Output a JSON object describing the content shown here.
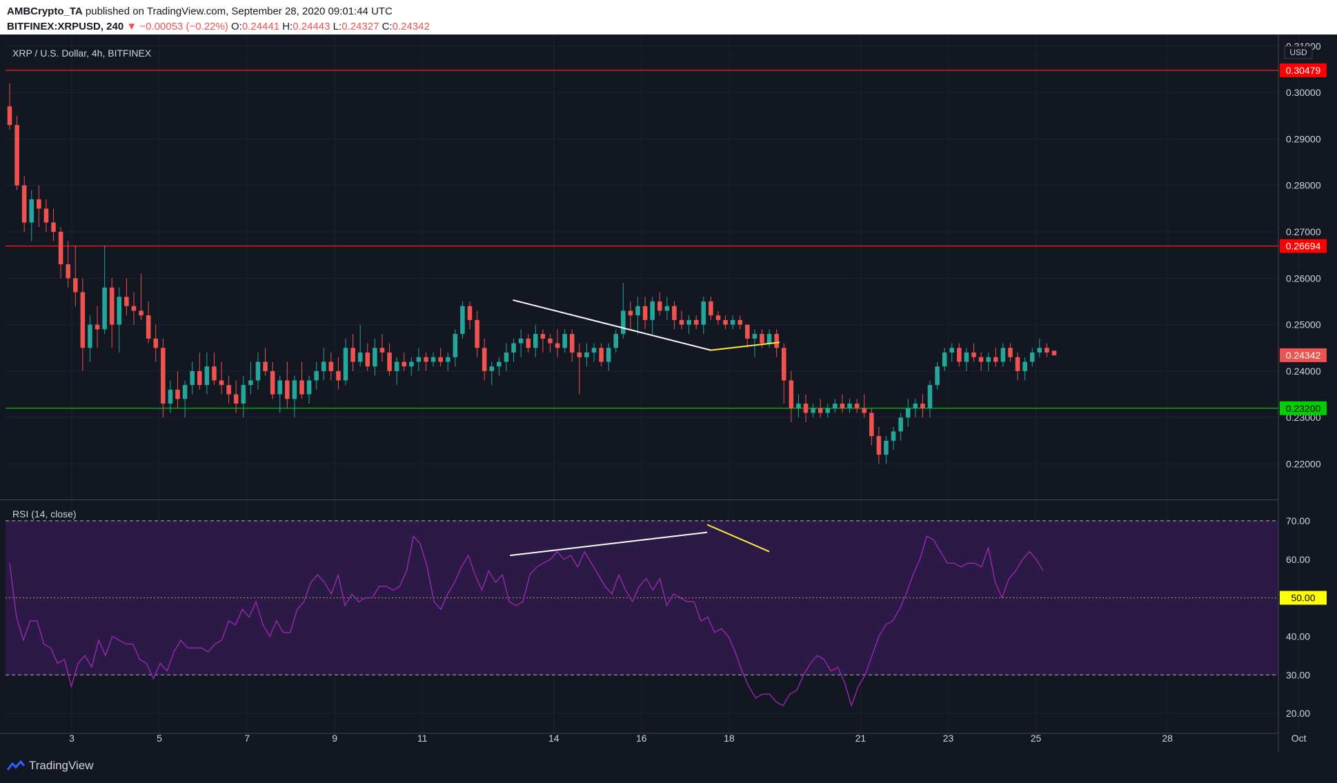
{
  "header": {
    "publisher": "AMBCrypto_TA",
    "published_text": " published on TradingView.com, September 28, 2020 09:01:44 UTC",
    "symbol": "BITFINEX:XRPUSD, 240",
    "change": "▼ −0.00053 (−0.22%)",
    "o_label": "O:",
    "o_value": "0.24441",
    "h_label": "H:",
    "h_value": "0.24443",
    "l_label": "L:",
    "l_value": "0.24327",
    "c_label": "C:",
    "c_value": "0.24342"
  },
  "footer": {
    "brand": "TradingView",
    "logo_icon": "tradingview-logo-icon"
  },
  "colors": {
    "background": "#131722",
    "grid": "#1e222d",
    "up": "#26a69a",
    "down": "#ef5350",
    "resistance": "#ff1e1e",
    "support": "#00c800",
    "rsi": "#9c27b0",
    "rsi_band": "#2a1a45",
    "trend_white": "#ffffff",
    "trend_yellow": "#ffeb3b"
  },
  "chart_data": [
    {
      "type": "candlestick",
      "title": "XRP / U.S. Dollar, 4h, BITFINEX",
      "currency_label": "USD",
      "ylim": [
        0.2125,
        0.3125
      ],
      "y_ticks": [
        "0.31000",
        "0.30000",
        "0.29000",
        "0.28000",
        "0.27000",
        "0.26000",
        "0.25000",
        "0.24000",
        "0.23000",
        "0.22000"
      ],
      "x_ticks": [
        "3",
        "5",
        "7",
        "9",
        "11",
        "14",
        "16",
        "18",
        "21",
        "23",
        "25",
        "28",
        "Oct",
        "3"
      ],
      "horizontal_levels": [
        {
          "value": 0.30479,
          "label": "0.30479",
          "color": "#ff1e1e"
        },
        {
          "value": 0.26694,
          "label": "0.26694",
          "color": "#ff1e1e"
        },
        {
          "value": 0.232,
          "label": "0.23200",
          "color": "#00c800"
        }
      ],
      "last_price": {
        "value": 0.24342,
        "label": "0.24342"
      },
      "trendlines": [
        {
          "color": "white",
          "points": [
            [
              68.9,
              0.2553
            ],
            [
              96.0,
              0.2445
            ]
          ]
        },
        {
          "color": "yellow",
          "points": [
            [
              96.0,
              0.2445
            ],
            [
              105.4,
              0.2462
            ]
          ]
        }
      ],
      "candles": [
        [
          0.297,
          0.302,
          0.292,
          0.293
        ],
        [
          0.293,
          0.295,
          0.279,
          0.28
        ],
        [
          0.28,
          0.282,
          0.27,
          0.272
        ],
        [
          0.272,
          0.279,
          0.268,
          0.277
        ],
        [
          0.277,
          0.28,
          0.271,
          0.275
        ],
        [
          0.275,
          0.277,
          0.27,
          0.272
        ],
        [
          0.272,
          0.275,
          0.268,
          0.27
        ],
        [
          0.27,
          0.271,
          0.26,
          0.263
        ],
        [
          0.263,
          0.268,
          0.258,
          0.26
        ],
        [
          0.26,
          0.267,
          0.254,
          0.257
        ],
        [
          0.257,
          0.26,
          0.24,
          0.245
        ],
        [
          0.245,
          0.252,
          0.242,
          0.25
        ],
        [
          0.25,
          0.254,
          0.245,
          0.249
        ],
        [
          0.249,
          0.267,
          0.248,
          0.258
        ],
        [
          0.258,
          0.26,
          0.245,
          0.25
        ],
        [
          0.25,
          0.258,
          0.244,
          0.256
        ],
        [
          0.256,
          0.26,
          0.252,
          0.254
        ],
        [
          0.254,
          0.257,
          0.25,
          0.253
        ],
        [
          0.253,
          0.261,
          0.251,
          0.252
        ],
        [
          0.252,
          0.255,
          0.246,
          0.247
        ],
        [
          0.247,
          0.25,
          0.242,
          0.245
        ],
        [
          0.245,
          0.247,
          0.23,
          0.233
        ],
        [
          0.233,
          0.238,
          0.231,
          0.236
        ],
        [
          0.236,
          0.24,
          0.232,
          0.234
        ],
        [
          0.234,
          0.238,
          0.23,
          0.237
        ],
        [
          0.237,
          0.242,
          0.235,
          0.24
        ],
        [
          0.24,
          0.244,
          0.236,
          0.237
        ],
        [
          0.237,
          0.244,
          0.235,
          0.241
        ],
        [
          0.241,
          0.244,
          0.237,
          0.238
        ],
        [
          0.238,
          0.242,
          0.235,
          0.237
        ],
        [
          0.237,
          0.239,
          0.233,
          0.235
        ],
        [
          0.235,
          0.238,
          0.231,
          0.233
        ],
        [
          0.233,
          0.239,
          0.23,
          0.237
        ],
        [
          0.237,
          0.242,
          0.235,
          0.238
        ],
        [
          0.238,
          0.244,
          0.236,
          0.242
        ],
        [
          0.242,
          0.245,
          0.239,
          0.24
        ],
        [
          0.24,
          0.242,
          0.234,
          0.235
        ],
        [
          0.235,
          0.239,
          0.231,
          0.238
        ],
        [
          0.238,
          0.242,
          0.232,
          0.234
        ],
        [
          0.234,
          0.239,
          0.23,
          0.238
        ],
        [
          0.238,
          0.242,
          0.234,
          0.235
        ],
        [
          0.235,
          0.239,
          0.233,
          0.238
        ],
        [
          0.238,
          0.242,
          0.236,
          0.24
        ],
        [
          0.24,
          0.245,
          0.238,
          0.242
        ],
        [
          0.242,
          0.244,
          0.238,
          0.24
        ],
        [
          0.24,
          0.243,
          0.236,
          0.238
        ],
        [
          0.238,
          0.247,
          0.237,
          0.245
        ],
        [
          0.245,
          0.248,
          0.24,
          0.242
        ],
        [
          0.242,
          0.25,
          0.241,
          0.244
        ],
        [
          0.244,
          0.246,
          0.24,
          0.241
        ],
        [
          0.241,
          0.247,
          0.239,
          0.245
        ],
        [
          0.245,
          0.248,
          0.242,
          0.244
        ],
        [
          0.244,
          0.246,
          0.239,
          0.24
        ],
        [
          0.24,
          0.243,
          0.237,
          0.242
        ],
        [
          0.242,
          0.244,
          0.24,
          0.241
        ],
        [
          0.241,
          0.243,
          0.239,
          0.242
        ],
        [
          0.242,
          0.245,
          0.24,
          0.243
        ],
        [
          0.243,
          0.244,
          0.24,
          0.242
        ],
        [
          0.242,
          0.244,
          0.241,
          0.243
        ],
        [
          0.243,
          0.245,
          0.241,
          0.242
        ],
        [
          0.242,
          0.244,
          0.24,
          0.243
        ],
        [
          0.243,
          0.249,
          0.241,
          0.248
        ],
        [
          0.248,
          0.255,
          0.247,
          0.254
        ],
        [
          0.254,
          0.255,
          0.249,
          0.251
        ],
        [
          0.251,
          0.253,
          0.243,
          0.245
        ],
        [
          0.245,
          0.247,
          0.238,
          0.24
        ],
        [
          0.24,
          0.242,
          0.237,
          0.241
        ],
        [
          0.241,
          0.243,
          0.239,
          0.242
        ],
        [
          0.242,
          0.246,
          0.24,
          0.244
        ],
        [
          0.244,
          0.247,
          0.242,
          0.246
        ],
        [
          0.246,
          0.249,
          0.243,
          0.247
        ],
        [
          0.247,
          0.248,
          0.244,
          0.245
        ],
        [
          0.245,
          0.25,
          0.243,
          0.248
        ],
        [
          0.248,
          0.249,
          0.244,
          0.247
        ],
        [
          0.247,
          0.248,
          0.244,
          0.246
        ],
        [
          0.246,
          0.249,
          0.243,
          0.245
        ],
        [
          0.245,
          0.249,
          0.244,
          0.248
        ],
        [
          0.248,
          0.249,
          0.242,
          0.244
        ],
        [
          0.244,
          0.246,
          0.235,
          0.243
        ],
        [
          0.243,
          0.246,
          0.241,
          0.244
        ],
        [
          0.244,
          0.246,
          0.242,
          0.245
        ],
        [
          0.245,
          0.246,
          0.241,
          0.242
        ],
        [
          0.242,
          0.246,
          0.24,
          0.245
        ],
        [
          0.245,
          0.249,
          0.244,
          0.248
        ],
        [
          0.248,
          0.259,
          0.247,
          0.253
        ],
        [
          0.253,
          0.255,
          0.249,
          0.252
        ],
        [
          0.252,
          0.256,
          0.248,
          0.254
        ],
        [
          0.254,
          0.256,
          0.249,
          0.251
        ],
        [
          0.251,
          0.256,
          0.248,
          0.255
        ],
        [
          0.255,
          0.257,
          0.252,
          0.253
        ],
        [
          0.253,
          0.256,
          0.251,
          0.254
        ],
        [
          0.254,
          0.255,
          0.249,
          0.251
        ],
        [
          0.251,
          0.253,
          0.249,
          0.25
        ],
        [
          0.25,
          0.252,
          0.248,
          0.251
        ],
        [
          0.251,
          0.252,
          0.249,
          0.25
        ],
        [
          0.25,
          0.256,
          0.248,
          0.255
        ],
        [
          0.255,
          0.256,
          0.251,
          0.252
        ],
        [
          0.252,
          0.253,
          0.25,
          0.251
        ],
        [
          0.251,
          0.252,
          0.249,
          0.25
        ],
        [
          0.25,
          0.252,
          0.249,
          0.251
        ],
        [
          0.251,
          0.252,
          0.249,
          0.25
        ],
        [
          0.25,
          0.25,
          0.245,
          0.247
        ],
        [
          0.247,
          0.249,
          0.243,
          0.248
        ],
        [
          0.248,
          0.249,
          0.245,
          0.246
        ],
        [
          0.246,
          0.249,
          0.245,
          0.248
        ],
        [
          0.248,
          0.249,
          0.243,
          0.245
        ],
        [
          0.245,
          0.246,
          0.233,
          0.238
        ],
        [
          0.238,
          0.24,
          0.229,
          0.232
        ],
        [
          0.232,
          0.235,
          0.23,
          0.233
        ],
        [
          0.233,
          0.235,
          0.229,
          0.231
        ],
        [
          0.231,
          0.233,
          0.23,
          0.232
        ],
        [
          0.232,
          0.234,
          0.23,
          0.231
        ],
        [
          0.231,
          0.233,
          0.23,
          0.232
        ],
        [
          0.232,
          0.234,
          0.231,
          0.233
        ],
        [
          0.233,
          0.235,
          0.231,
          0.232
        ],
        [
          0.232,
          0.234,
          0.231,
          0.233
        ],
        [
          0.233,
          0.234,
          0.231,
          0.232
        ],
        [
          0.232,
          0.235,
          0.23,
          0.231
        ],
        [
          0.231,
          0.232,
          0.224,
          0.226
        ],
        [
          0.226,
          0.228,
          0.22,
          0.222
        ],
        [
          0.222,
          0.226,
          0.22,
          0.225
        ],
        [
          0.225,
          0.228,
          0.223,
          0.227
        ],
        [
          0.227,
          0.231,
          0.225,
          0.23
        ],
        [
          0.23,
          0.234,
          0.228,
          0.232
        ],
        [
          0.232,
          0.234,
          0.23,
          0.233
        ],
        [
          0.233,
          0.235,
          0.23,
          0.232
        ],
        [
          0.232,
          0.238,
          0.23,
          0.237
        ],
        [
          0.237,
          0.242,
          0.236,
          0.241
        ],
        [
          0.241,
          0.245,
          0.24,
          0.244
        ],
        [
          0.244,
          0.246,
          0.242,
          0.245
        ],
        [
          0.245,
          0.246,
          0.241,
          0.242
        ],
        [
          0.242,
          0.245,
          0.24,
          0.244
        ],
        [
          0.244,
          0.246,
          0.242,
          0.243
        ],
        [
          0.243,
          0.244,
          0.24,
          0.242
        ],
        [
          0.242,
          0.244,
          0.24,
          0.243
        ],
        [
          0.243,
          0.245,
          0.241,
          0.242
        ],
        [
          0.242,
          0.246,
          0.241,
          0.245
        ],
        [
          0.245,
          0.246,
          0.242,
          0.243
        ],
        [
          0.243,
          0.244,
          0.238,
          0.24
        ],
        [
          0.24,
          0.243,
          0.238,
          0.242
        ],
        [
          0.242,
          0.245,
          0.241,
          0.244
        ],
        [
          0.244,
          0.247,
          0.243,
          0.245
        ],
        [
          0.245,
          0.246,
          0.243,
          0.244
        ],
        [
          0.2444,
          0.2444,
          0.2433,
          0.2434
        ]
      ]
    },
    {
      "type": "line",
      "title": "RSI (14, close)",
      "ylim": [
        15,
        75
      ],
      "y_ticks": [
        "70.00",
        "60.00",
        "50.00",
        "40.00",
        "30.00",
        "20.00"
      ],
      "levels": [
        70,
        50,
        30
      ],
      "level_label": "50.00",
      "trendlines": [
        {
          "color": "white",
          "points": [
            [
              68.5,
              61
            ],
            [
              95.5,
              67
            ]
          ]
        },
        {
          "color": "yellow",
          "points": [
            [
              95.5,
              69
            ],
            [
              104.0,
              62
            ]
          ]
        }
      ],
      "values": [
        59,
        45,
        39,
        44,
        44,
        38,
        37,
        33,
        34,
        27,
        33,
        35,
        32,
        39,
        35,
        40,
        39,
        38,
        38,
        34,
        33,
        29,
        33,
        31,
        36,
        39,
        37,
        37,
        37,
        36,
        38,
        39,
        44,
        43,
        47,
        45,
        49,
        43,
        40,
        44,
        41,
        41,
        47,
        49,
        54,
        56,
        54,
        51,
        56,
        48,
        51,
        49,
        50,
        50,
        53,
        53,
        52,
        53,
        57,
        66,
        64,
        58,
        49,
        47,
        51,
        54,
        58,
        61,
        56,
        52,
        57,
        54,
        56,
        49,
        48,
        49,
        56,
        58,
        59,
        60,
        62,
        60,
        61,
        58,
        62,
        59,
        56,
        53,
        51,
        56,
        52,
        49,
        53,
        55,
        52,
        55,
        48,
        51,
        50,
        49,
        49,
        44,
        45,
        41,
        42,
        40,
        36,
        31,
        27,
        24,
        25,
        25,
        23,
        22,
        25,
        26,
        30,
        33,
        35,
        34,
        31,
        32,
        28,
        22,
        27,
        30,
        35,
        40,
        43,
        44,
        47,
        51,
        56,
        60,
        66,
        65,
        62,
        59,
        59,
        58,
        59,
        59,
        58,
        63,
        54,
        50,
        55,
        57,
        60,
        62,
        60,
        57
      ]
    }
  ]
}
